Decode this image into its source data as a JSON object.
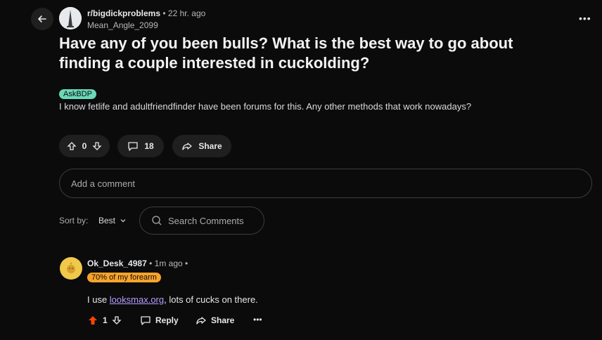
{
  "post": {
    "subreddit": "r/bigdickproblems",
    "time": "22 hr. ago",
    "author": "Mean_Angle_2099",
    "title": "Have any of you been bulls? What is the best way to go about finding a couple interested in cuckolding?",
    "flair": "AskBDP",
    "body": "I know fetlife and adultfriendfinder have been forums for this. Any other methods that work nowadays?",
    "votes": "0",
    "comments_count": "18",
    "share_label": "Share"
  },
  "comment_input": {
    "placeholder": "Add a comment"
  },
  "sort": {
    "label": "Sort by:",
    "value": "Best"
  },
  "search": {
    "placeholder": "Search Comments"
  },
  "comment": {
    "author": "Ok_Desk_4987",
    "time": "1m ago",
    "flair": "70% of my forearm",
    "text_before": "I use ",
    "link_text": "looksmax.org",
    "text_after": ", lots of cucks on there.",
    "votes": "1",
    "reply_label": "Reply",
    "share_label": "Share"
  },
  "colors": {
    "upvote": "#ff4500",
    "flair_post": "#6ad9b7",
    "flair_user": "#f7a32b",
    "link": "#b79cff"
  },
  "icons": [
    "back-arrow-icon",
    "more-options-icon",
    "upvote-icon",
    "downvote-icon",
    "comment-icon",
    "share-icon",
    "search-icon",
    "chevron-down-icon"
  ]
}
